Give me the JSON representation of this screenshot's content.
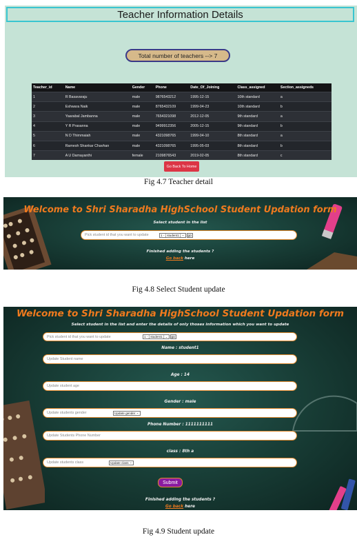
{
  "fig1": {
    "title": "Teacher Information Details",
    "total": "Total number of teachers --> 7",
    "headers": [
      "Teacher_id",
      "Name",
      "Gender",
      "Phone",
      "Date_Of_Joining",
      "Class_assigned",
      "Section_assigneds"
    ],
    "rows": [
      [
        "1",
        "R Basavaraju",
        "male",
        "9876543212",
        "1995-12-15",
        "10th standard",
        "a"
      ],
      [
        "2",
        "Eshwara Naik",
        "male",
        "8765432109",
        "1999-04-23",
        "10th standard",
        "b"
      ],
      [
        "3",
        "Yaarabal Jambanna",
        "male",
        "7654321098",
        "2012-12-05",
        "9th standard",
        "a"
      ],
      [
        "4",
        "Y R Prasanna",
        "male",
        "9499912356",
        "2005-12-15",
        "9th standard",
        "b"
      ],
      [
        "5",
        "N D Thimmaiah",
        "male",
        "4321098765",
        "1999-04-10",
        "8th standard",
        "a"
      ],
      [
        "6",
        "Ramesh Shankar Chavhan",
        "male",
        "4321098765",
        "1995-05-03",
        "8th standard",
        "b"
      ],
      [
        "7",
        "A U Damayanthi",
        "female",
        "2109876543",
        "2019-02-05",
        "8th standard",
        "c"
      ]
    ],
    "home_button": "Go Back To Home",
    "caption": "Fig 4.7 Teacher detail"
  },
  "fig2": {
    "title": "Welcome to Shri Sharadha HighSchool Student Updation form",
    "instruction": "Select student in the list",
    "placeholder": "Pick student id that you want to update",
    "select_value": "1 - [ student1 ]",
    "go_label": "go",
    "finished": "Finished adding the students ?",
    "go_back": "Go back",
    "here": "here",
    "caption": "Fig 4.8 Select Student update"
  },
  "fig3": {
    "title": "Welcome to Shri Sharadha HighSchool Student Updation form",
    "instruction": "Select student in the list and enter the details of only thoses information which you want to update",
    "pick_placeholder": "Pick student id that you want to update",
    "select_value": "1 - [ student1 ]",
    "go_label": "go",
    "name_label": "Name : student1",
    "name_placeholder": "Update Student name",
    "age_label": "Age : 14",
    "age_placeholder": "Update student age",
    "gender_label": "Gender : male",
    "gender_placeholder": "Update students gender",
    "gender_select": "Update gender",
    "phone_label": "Phone Number : 1111111111",
    "phone_placeholder": "Update Students Phone Number",
    "class_label": "class : 8th a",
    "class_placeholder": "Update students class",
    "class_select": "Update class",
    "submit": "Submit",
    "finished": "Finished adding the students ?",
    "go_back": "Go back",
    "here": "here",
    "caption": "Fig 4.9 Student update"
  },
  "colors": {
    "panel1_bg": "#c5e3d6",
    "title_border": "#39c5d0",
    "home_button": "#dc3545",
    "board_orange": "#ef7a1e",
    "submit_purple": "#8a1aa0"
  }
}
